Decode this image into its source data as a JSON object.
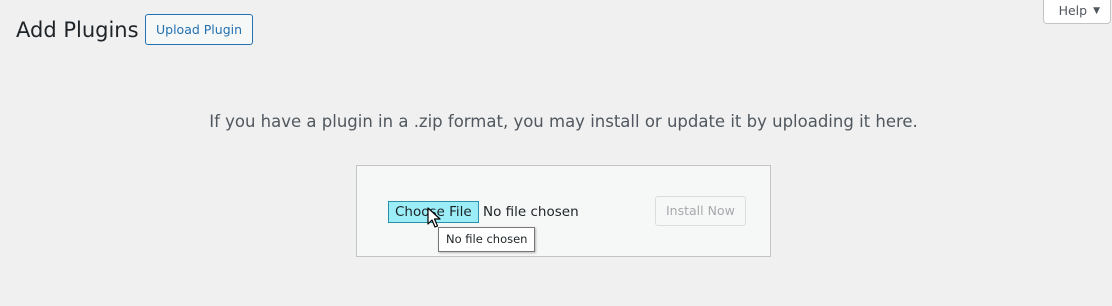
{
  "header": {
    "title": "Add Plugins",
    "upload_button_label": "Upload Plugin",
    "help_label": "Help",
    "help_arrow": "▼"
  },
  "upload": {
    "description": "If you have a plugin in a .zip format, you may install or update it by uploading it here.",
    "choose_file_label": "Choose File",
    "file_status": "No file chosen",
    "install_button_label": "Install Now",
    "tooltip": "No file chosen"
  },
  "icons": {
    "help_dropdown": "caret-down-icon",
    "pointer": "mouse-pointer-icon"
  },
  "colors": {
    "background": "#f0f0f1",
    "accent": "#2271b1",
    "choose_file_highlight": "#9beef8",
    "disabled_text": "#a7aaad"
  }
}
